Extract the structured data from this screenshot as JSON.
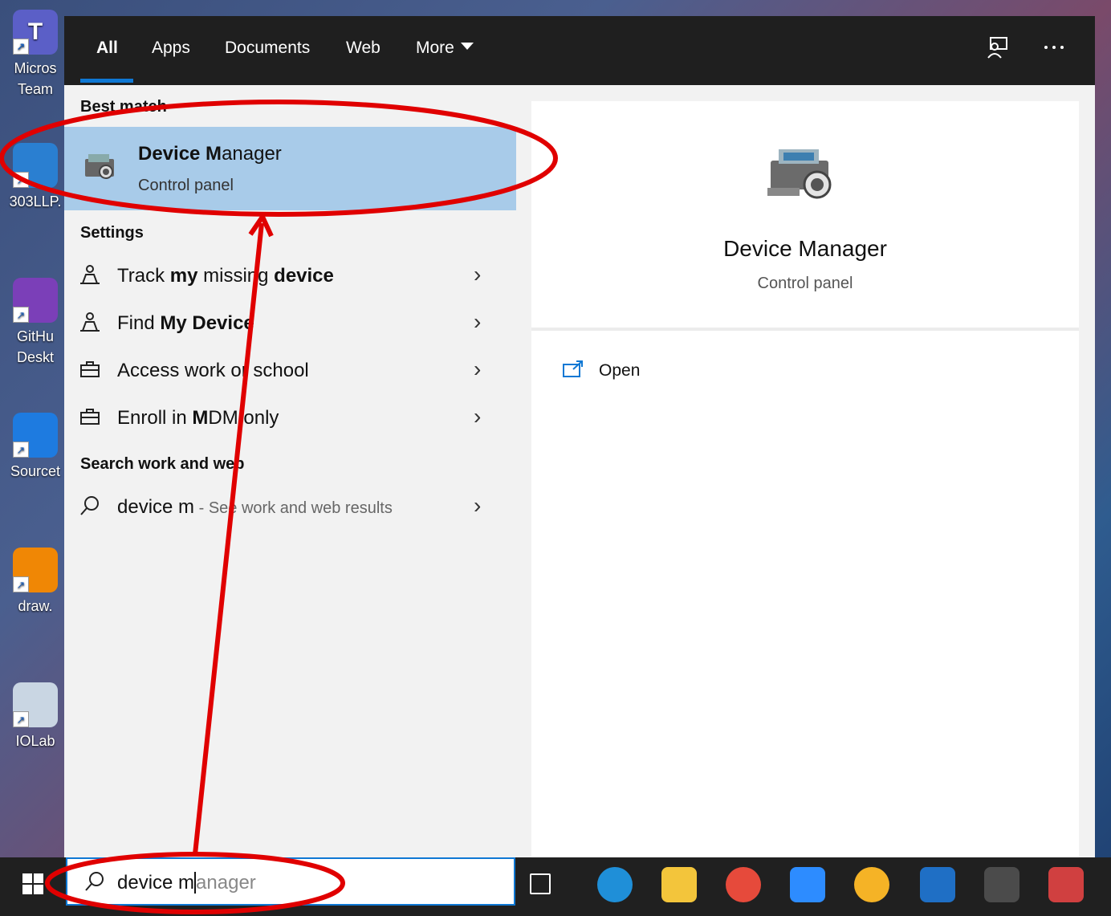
{
  "desktop": {
    "icons": [
      {
        "label": "Micros\nTeam",
        "icon": "teams-icon",
        "color": "#5b5fc7",
        "letter": "T"
      },
      {
        "label": "303LLP.",
        "icon": "computer-icon",
        "color": "#2a7fd1",
        "letter": ""
      },
      {
        "label": "GitHu\nDeskt",
        "icon": "github-desktop-icon",
        "color": "#7b3fb8",
        "letter": ""
      },
      {
        "label": "Sourcet",
        "icon": "sourcetree-icon",
        "color": "#1e7be0",
        "letter": ""
      },
      {
        "label": "draw.",
        "icon": "drawio-icon",
        "color": "#f08705",
        "letter": ""
      },
      {
        "label": "IOLab",
        "icon": "iolab-icon",
        "color": "#c9d6e3",
        "letter": ""
      }
    ]
  },
  "search_panel": {
    "tabs": [
      {
        "label": "All",
        "active": true
      },
      {
        "label": "Apps",
        "active": false
      },
      {
        "label": "Documents",
        "active": false
      },
      {
        "label": "Web",
        "active": false
      },
      {
        "label": "More",
        "active": false
      }
    ],
    "top_icons": [
      "feedback-icon",
      "more-options-icon"
    ],
    "best_match": {
      "heading": "Best match",
      "name_bold": "Device M",
      "name_rest": "anager",
      "subtitle": "Control panel",
      "icon": "device-manager-icon"
    },
    "settings": {
      "heading": "Settings",
      "items": [
        {
          "icon": "person-location-icon",
          "pre": "Track ",
          "bold1": "my",
          "mid": " missing ",
          "bold2": "device"
        },
        {
          "icon": "person-location-icon",
          "pre": "Find ",
          "bold1": "My",
          "mid": " ",
          "bold2": "Device"
        },
        {
          "icon": "briefcase-icon",
          "pre": "Access work or school",
          "bold1": "",
          "mid": "",
          "bold2": ""
        },
        {
          "icon": "briefcase-icon",
          "pre": "Enroll in ",
          "bold1": "M",
          "mid": "DM only",
          "bold2": ""
        }
      ]
    },
    "web": {
      "heading": "Search work and web",
      "query": "device m",
      "suffix": " - See work and web results"
    },
    "preview": {
      "title": "Device Manager",
      "subtitle": "Control panel",
      "action": "Open"
    }
  },
  "taskbar": {
    "search_typed": "device m",
    "search_ghost": "anager",
    "icons": [
      {
        "name": "task-view-icon",
        "color": "#202020"
      },
      {
        "name": "edge-icon",
        "color": "#1f8fd8"
      },
      {
        "name": "file-explorer-icon",
        "color": "#f3c53b"
      },
      {
        "name": "chrome-icon",
        "color": "#e64a3b"
      },
      {
        "name": "zoom-icon",
        "color": "#2d8cff"
      },
      {
        "name": "weather-icon",
        "color": "#f5b326"
      },
      {
        "name": "outlook-icon",
        "color": "#1f6fc5"
      },
      {
        "name": "sublime-icon",
        "color": "#4b4b4b"
      },
      {
        "name": "snipping-tool-icon",
        "color": "#d04040"
      }
    ]
  },
  "annotation": {
    "color": "#e00000"
  }
}
